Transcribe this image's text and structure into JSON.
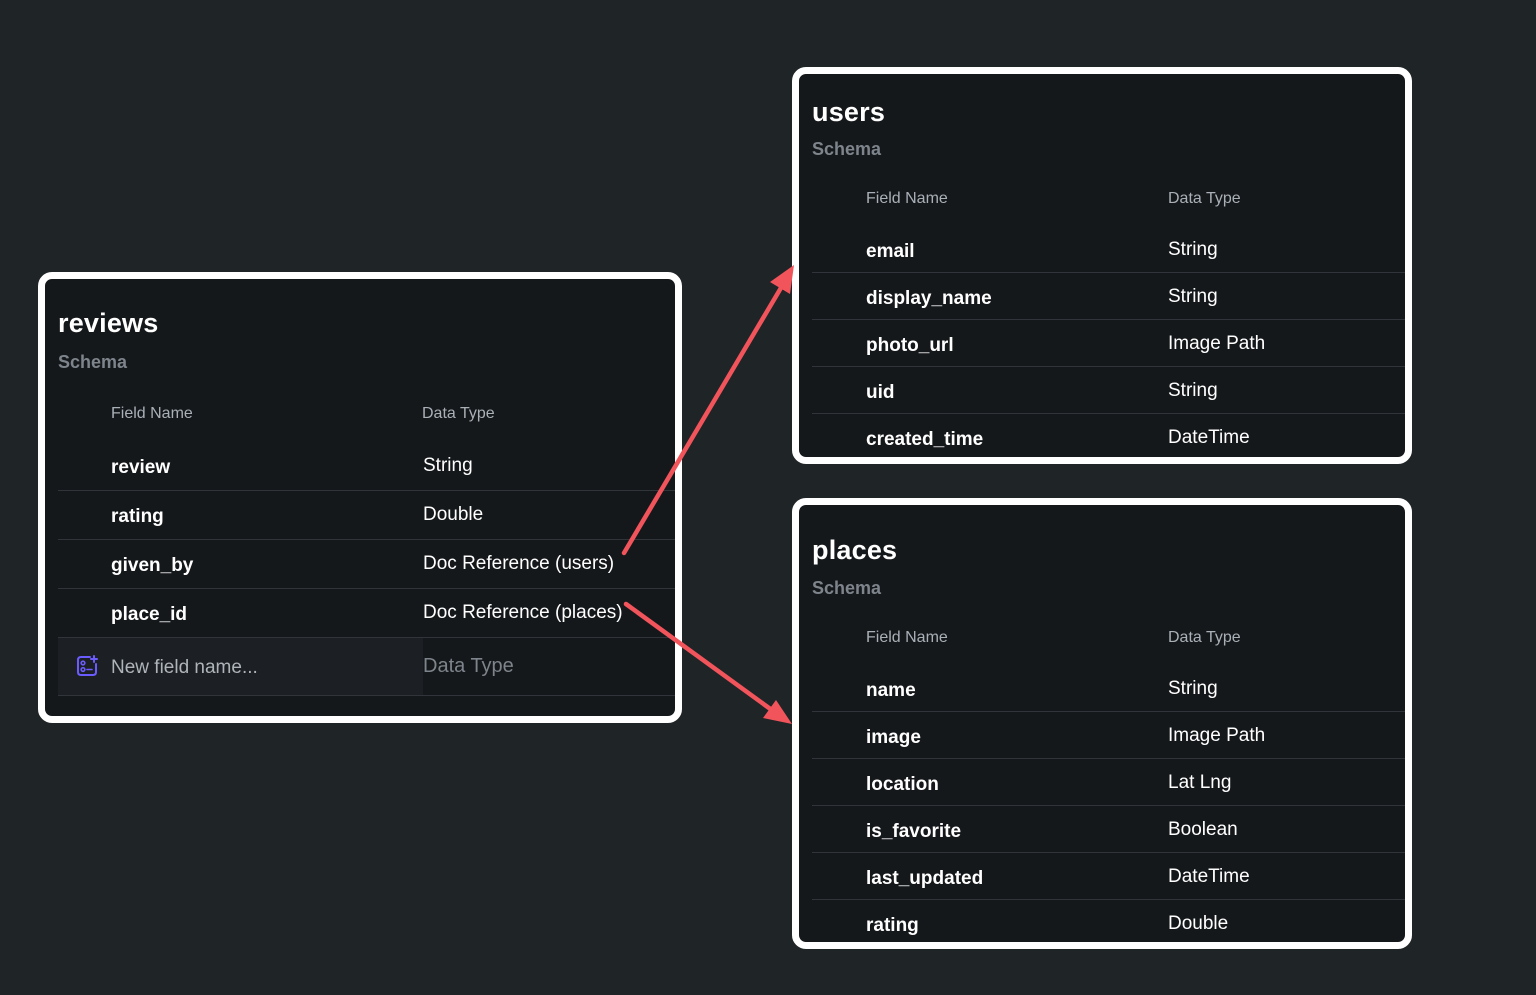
{
  "reviews": {
    "title": "reviews",
    "subtitle": "Schema",
    "header_name": "Field Name",
    "header_type": "Data Type",
    "fields": [
      {
        "name": "review",
        "type": "String"
      },
      {
        "name": "rating",
        "type": "Double"
      },
      {
        "name": "given_by",
        "type": "Doc Reference (users)"
      },
      {
        "name": "place_id",
        "type": "Doc Reference (places)"
      }
    ],
    "new_field_placeholder": "New field name...",
    "new_type_placeholder": "Data Type"
  },
  "users": {
    "title": "users",
    "subtitle": "Schema",
    "header_name": "Field Name",
    "header_type": "Data Type",
    "fields": [
      {
        "name": "email",
        "type": "String"
      },
      {
        "name": "display_name",
        "type": "String"
      },
      {
        "name": "photo_url",
        "type": "Image Path"
      },
      {
        "name": "uid",
        "type": "String"
      },
      {
        "name": "created_time",
        "type": "DateTime"
      }
    ]
  },
  "places": {
    "title": "places",
    "subtitle": "Schema",
    "header_name": "Field Name",
    "header_type": "Data Type",
    "fields": [
      {
        "name": "name",
        "type": "String"
      },
      {
        "name": "image",
        "type": "Image Path"
      },
      {
        "name": "location",
        "type": "Lat Lng"
      },
      {
        "name": "is_favorite",
        "type": "Boolean"
      },
      {
        "name": "last_updated",
        "type": "DateTime"
      },
      {
        "name": "rating",
        "type": "Double"
      }
    ]
  },
  "colors": {
    "background": "#1f2427",
    "card": "#15181b",
    "border": "#ffffff",
    "arrow": "#f2545b",
    "icon_accent": "#6b5cff"
  }
}
